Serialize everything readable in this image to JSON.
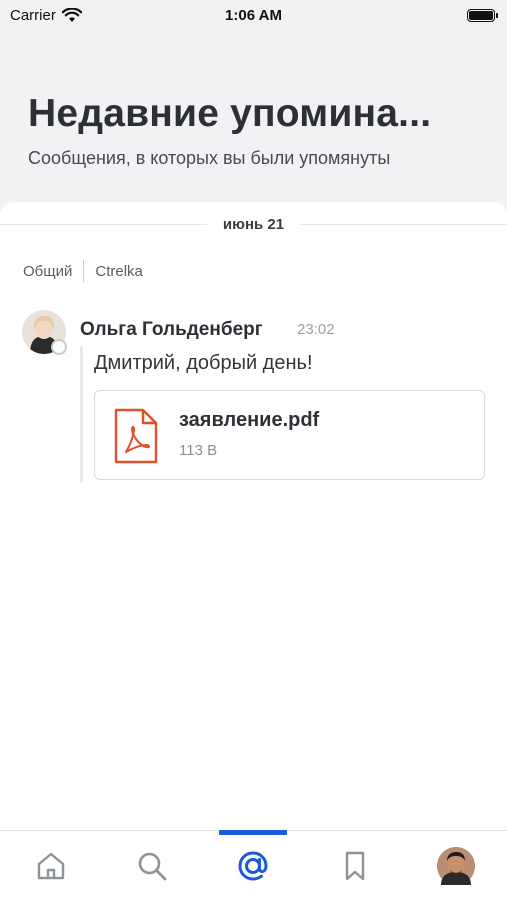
{
  "status_bar": {
    "carrier": "Carrier",
    "time": "1:06 AM",
    "wifi_icon": "wifi-icon",
    "battery_icon": "battery-icon"
  },
  "header": {
    "title": "Недавние упомина...",
    "subtitle": "Сообщения, в которых вы были упомянуты"
  },
  "feed": {
    "date": "июнь 21",
    "breadcrumb": {
      "workspace": "Общий",
      "channel": "Ctrelka"
    },
    "message": {
      "author": "Ольга Гольденберг",
      "time": "23:02",
      "text": "Дмитрий, добрый день!",
      "attachment": {
        "name": "заявление.pdf",
        "size": "113 B",
        "icon": "pdf-file-icon",
        "color": "#e0502d"
      }
    }
  },
  "tab_bar": {
    "accent": "#1a5bd6",
    "inactive_color": "#8e939a",
    "tabs": [
      {
        "name": "home",
        "icon": "home-icon",
        "active": false
      },
      {
        "name": "search",
        "icon": "search-icon",
        "active": false
      },
      {
        "name": "mentions",
        "icon": "at-sign-icon",
        "active": true
      },
      {
        "name": "saved",
        "icon": "bookmark-icon",
        "active": false
      },
      {
        "name": "profile",
        "icon": "avatar",
        "active": false
      }
    ]
  }
}
